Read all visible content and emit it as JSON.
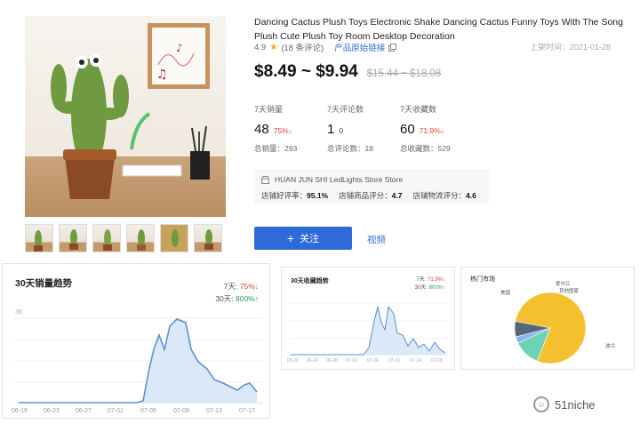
{
  "product": {
    "title": "Dancing Cactus Plush Toys Electronic Shake Dancing Cactus Funny Toys With The Song Plush Cute Plush Toy Room Desktop Decoration",
    "rating": "4.9",
    "review_count": "(18 条评论)",
    "original_link": "产品原始链接",
    "listed_label": "上架时间：2021-01-28",
    "price": "$8.49 ~ $9.94",
    "old_price": "$15.44 ~ $18.08",
    "thumbnail_count": 6
  },
  "stats": [
    {
      "label": "7天销量",
      "value": "48",
      "change": "75%↓",
      "change_color": "red",
      "sub": "总销量：293"
    },
    {
      "label": "7天评论数",
      "value": "1",
      "change": "0",
      "change_color": "gray",
      "sub": "总评论数：18"
    },
    {
      "label": "7天收藏数",
      "value": "60",
      "change": "71.9%↓",
      "change_color": "red",
      "sub": "总收藏数：529"
    }
  ],
  "store": {
    "name": "HUAN JUN SHI LedLights Store Store",
    "good_rate_label": "店铺好评率：",
    "good_rate": "95.1%",
    "product_score_label": "店铺商品评分：",
    "product_score": "4.7",
    "logistics_label": "店铺物流评分：",
    "logistics_score": "4.6"
  },
  "actions": {
    "follow_label": "关注",
    "video_label": "视频"
  },
  "sales_trend": {
    "title": "30天销量趋势",
    "legend_7d_prefix": "7天: ",
    "legend_7d": "75%↓",
    "legend_30d_prefix": "30天: ",
    "legend_30d": "800%↑",
    "y_tick": "36",
    "x_ticks": [
      "06-19",
      "06-23",
      "06-27",
      "07-01",
      "07-05",
      "07-09",
      "07-13",
      "07-17"
    ]
  },
  "fav_trend": {
    "title": "30天收藏趋势",
    "legend_7d_prefix": "7天: ",
    "legend_7d": "71.9%↓",
    "legend_30d_prefix": "30天: ",
    "legend_30d": "800%↑",
    "x_ticks": [
      "06-20",
      "06-24",
      "06-28",
      "07-02",
      "07-06",
      "07-10",
      "07-14",
      "07-18"
    ]
  },
  "market": {
    "title": "热门市场",
    "slices": [
      {
        "label": "波兰",
        "share": 0.78,
        "color": "#f4c02d"
      },
      {
        "label": "美国",
        "share": 0.12,
        "color": "#6ed3b6"
      },
      {
        "label": "爱尔兰",
        "share": 0.03,
        "color": "#8bb5ea"
      },
      {
        "label": "其他国家",
        "share": 0.07,
        "color": "#58657a"
      }
    ]
  },
  "colors": {
    "accent": "#2f6bd8",
    "line": "#5b8fd6",
    "fill": "#dbe8f8",
    "down": "#e04040",
    "up": "#2a9d52"
  },
  "watermark": "51niche"
}
